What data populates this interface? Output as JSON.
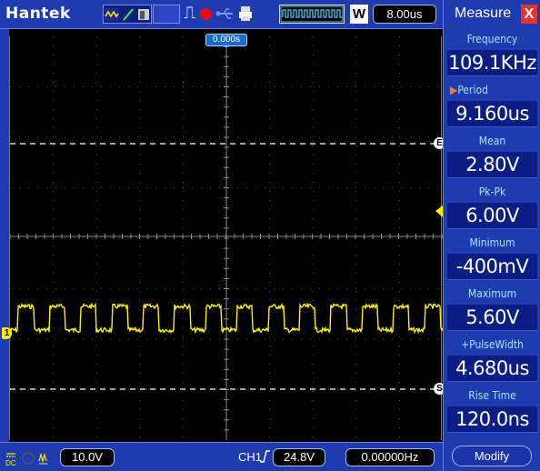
{
  "topbar": {
    "brand": "Hantek",
    "timebase": "8.00us",
    "w_label": "W"
  },
  "screen": {
    "trigger_position": "0.000s",
    "marker_e": "E",
    "marker_s": "S",
    "marker_ch": "1"
  },
  "bottombar": {
    "volts_div": "10.0V",
    "channel": "CH1",
    "trigger_level": "24.8V",
    "trigger_freq": "0.00000Hz"
  },
  "panel": {
    "title": "Measure",
    "close": "X",
    "measurements": [
      {
        "label": "Frequency",
        "value": "109.1KHz"
      },
      {
        "label": "Period",
        "value": "9.160us",
        "selected": true
      },
      {
        "label": "Mean",
        "value": "2.80V"
      },
      {
        "label": "Pk-Pk",
        "value": "6.00V"
      },
      {
        "label": "Minimum",
        "value": "-400mV"
      },
      {
        "label": "Maximum",
        "value": "5.60V"
      },
      {
        "label": "+PulseWidth",
        "value": "4.680us"
      },
      {
        "label": "Rise Time",
        "value": "120.0ns"
      }
    ],
    "modify_label": "Modify"
  },
  "colors": {
    "chrome_blue": "#1f3bb0",
    "trace_yellow": "#ffee00",
    "cursor_white": "#ffffff",
    "accent_orange": "#ff7a1a"
  }
}
